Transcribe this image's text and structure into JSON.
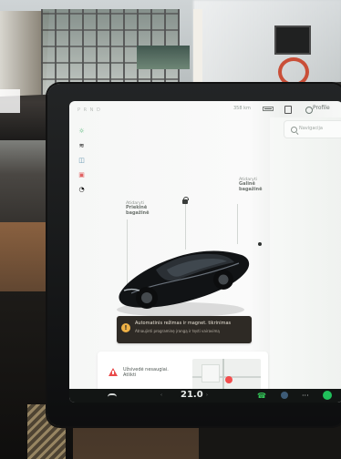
{
  "photo": {
    "screen": {
      "status": {
        "gear": "P R N D",
        "range_text": "358 km",
        "profile": "Profile"
      },
      "sidebar": {
        "icons": [
          "headlights-icon",
          "fog-icon",
          "car-icon",
          "alert-icon",
          "seatbelt-icon"
        ]
      },
      "vehicle": {
        "front_trunk": {
          "line1": "Atidaryti",
          "line2": "Priekinė",
          "line3": "bagažinė"
        },
        "rear_trunk": {
          "line1": "Atidaryti",
          "line2": "Galinė",
          "line3": "bagažinė"
        }
      },
      "alert": {
        "title": "Automatinis režimas ir magnet. tikrinimas",
        "subtitle": "Atnaujinti programinę įrangą ir tęsti vairavimą"
      },
      "card": {
        "text": "Užsivedė nesaugiai. Atlikti"
      },
      "map": {
        "search_placeholder": "Navigacija"
      },
      "taskbar": {
        "temp_main": "21.0",
        "temp_left": "‹",
        "temp_right": "›"
      }
    }
  }
}
